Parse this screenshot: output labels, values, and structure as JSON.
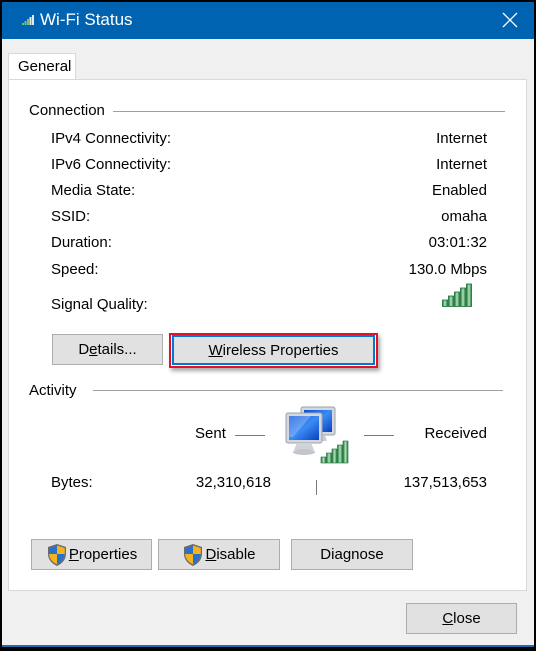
{
  "window": {
    "title": "Wi-Fi Status",
    "title_icon": "wifi-signal-icon",
    "close_icon": "close-icon",
    "accent_color": "#0063b1"
  },
  "tabs": [
    {
      "label": "General",
      "selected": true
    }
  ],
  "connection": {
    "heading": "Connection",
    "rows": [
      {
        "label": "IPv4 Connectivity:",
        "value": "Internet"
      },
      {
        "label": "IPv6 Connectivity:",
        "value": "Internet"
      },
      {
        "label": "Media State:",
        "value": "Enabled"
      },
      {
        "label": "SSID:",
        "value": "omaha"
      },
      {
        "label": "Duration:",
        "value": "03:01:32"
      },
      {
        "label": "Speed:",
        "value": "130.0 Mbps"
      }
    ],
    "signal_quality_label": "Signal Quality:",
    "signal_bars": 5,
    "signal_bars_max": 5,
    "details_button": {
      "pre": "D",
      "accel": "e",
      "post": "tails..."
    },
    "wireless_button": {
      "pre": "",
      "accel": "W",
      "post": "ireless Properties"
    },
    "highlight_color": "#e81123"
  },
  "activity": {
    "heading": "Activity",
    "sent_label": "Sent",
    "received_label": "Received",
    "bytes_label": "Bytes:",
    "bytes_sent": "32,310,618",
    "bytes_received": "137,513,653",
    "network_icon": "network-computers-icon"
  },
  "actions": {
    "properties_button": {
      "pre": "",
      "accel": "P",
      "post": "roperties",
      "icon": "uac-shield-icon"
    },
    "disable_button": {
      "pre": "",
      "accel": "D",
      "post": "isable",
      "icon": "uac-shield-icon"
    },
    "diagnose_button": {
      "pre": "Dia",
      "accel": "g",
      "post": "nose"
    }
  },
  "footer": {
    "close_button": {
      "pre": "",
      "accel": "C",
      "post": "lose"
    }
  }
}
